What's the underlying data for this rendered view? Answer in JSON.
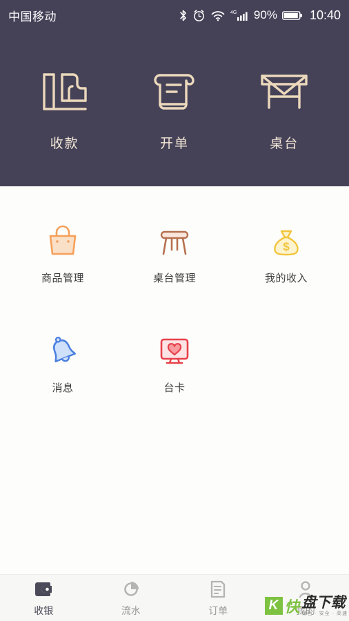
{
  "status_bar": {
    "carrier": "中国移动",
    "bluetooth_icon": "bluetooth-icon",
    "alarm_icon": "alarm-icon",
    "wifi_icon": "wifi-icon",
    "network_type": "4G",
    "signal_icon": "signal-bars-icon",
    "battery_percent": "90%",
    "battery_icon": "battery-icon",
    "time": "10:40"
  },
  "hero": {
    "items": [
      {
        "label": "收款",
        "icon": "cashier-counter-icon"
      },
      {
        "label": "开单",
        "icon": "scroll-receipt-icon"
      },
      {
        "label": "桌台",
        "icon": "table-icon"
      }
    ]
  },
  "grid": {
    "items": [
      {
        "label": "商品管理",
        "icon": "handbag-icon",
        "color": "#f5a05a"
      },
      {
        "label": "桌台管理",
        "icon": "stool-icon",
        "color": "#c07a5a"
      },
      {
        "label": "我的收入",
        "icon": "money-bag-icon",
        "color": "#f2c53d"
      },
      {
        "label": "消息",
        "icon": "bell-icon",
        "color": "#4a7fe0"
      },
      {
        "label": "台卡",
        "icon": "heart-monitor-icon",
        "color": "#e8404a"
      }
    ]
  },
  "tab_bar": {
    "tabs": [
      {
        "label": "收银",
        "icon": "wallet-icon",
        "active": true
      },
      {
        "label": "流水",
        "icon": "pie-chart-icon",
        "active": false
      },
      {
        "label": "订单",
        "icon": "order-list-icon",
        "active": false
      },
      {
        "label": "我的",
        "icon": "person-icon",
        "active": false
      }
    ]
  },
  "watermark": {
    "badge": "K",
    "brand": "快",
    "title": "盘下载",
    "subtitle": "绿色 · 安全 · 高速"
  },
  "colors": {
    "header_bg": "#454258",
    "hero_label": "#f3e6d5",
    "page_bg": "#fdfdfb",
    "tabbar_bg": "#f7f7f5",
    "tab_active": "#4a4a58",
    "tab_inactive": "#9a9a9a"
  }
}
